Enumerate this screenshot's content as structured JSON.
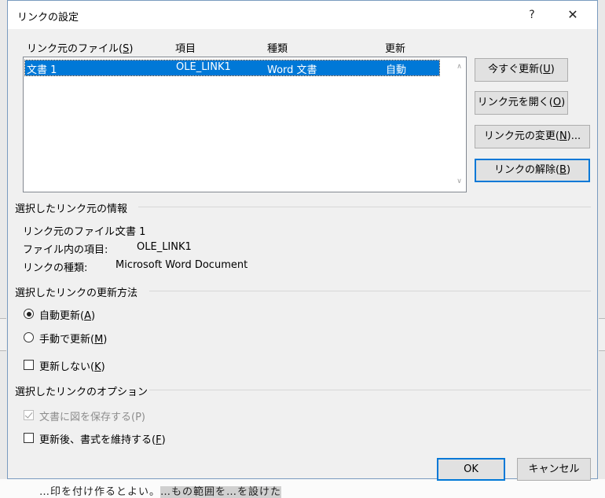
{
  "dialog": {
    "title": "リンクの設定",
    "help_label": "?",
    "close_label": "✕"
  },
  "columns": {
    "source": "リンク元のファイル(",
    "source_key": "S",
    "item": "項目",
    "type": "種類",
    "update": "更新"
  },
  "links": [
    {
      "source": "文書 1",
      "item": "OLE_LINK1",
      "type": "Word 文書",
      "update": "自動"
    }
  ],
  "buttons": {
    "update_now": {
      "label": "今すぐ更新(",
      "key": "U"
    },
    "open_source": {
      "label": "リンク元を開く(",
      "key": "O"
    },
    "change_source": {
      "label": "リンク元の変更(",
      "key": "N",
      "suffix": ")..."
    },
    "break_link": {
      "label": "リンクの解除(",
      "key": "B"
    },
    "ok": "OK",
    "cancel": "キャンセル"
  },
  "info_section": {
    "title": "選択したリンク元の情報",
    "source_file_label": "リンク元のファイル:",
    "source_file_value": "文書 1",
    "item_label": "ファイル内の項目:",
    "item_value": "OLE_LINK1",
    "type_label": "リンクの種類:",
    "type_value": "Microsoft Word Document"
  },
  "update_section": {
    "title": "選択したリンクの更新方法",
    "auto": {
      "label": "自動更新(",
      "key": "A",
      "checked": true
    },
    "manual": {
      "label": "手動で更新(",
      "key": "M",
      "checked": false
    },
    "locked": {
      "label": "更新しない(",
      "key": "K",
      "checked": false
    }
  },
  "options_section": {
    "title": "選択したリンクのオプション",
    "save_picture": {
      "label": "文書に図を保存する(P)",
      "checked": true,
      "disabled": true
    },
    "preserve_format": {
      "label": "更新後、書式を維持する(",
      "key": "F",
      "checked": false
    }
  },
  "background": {
    "text_before": "…印を付け作るとよい。",
    "text_highlight": "…もの範囲を…を設けた"
  }
}
